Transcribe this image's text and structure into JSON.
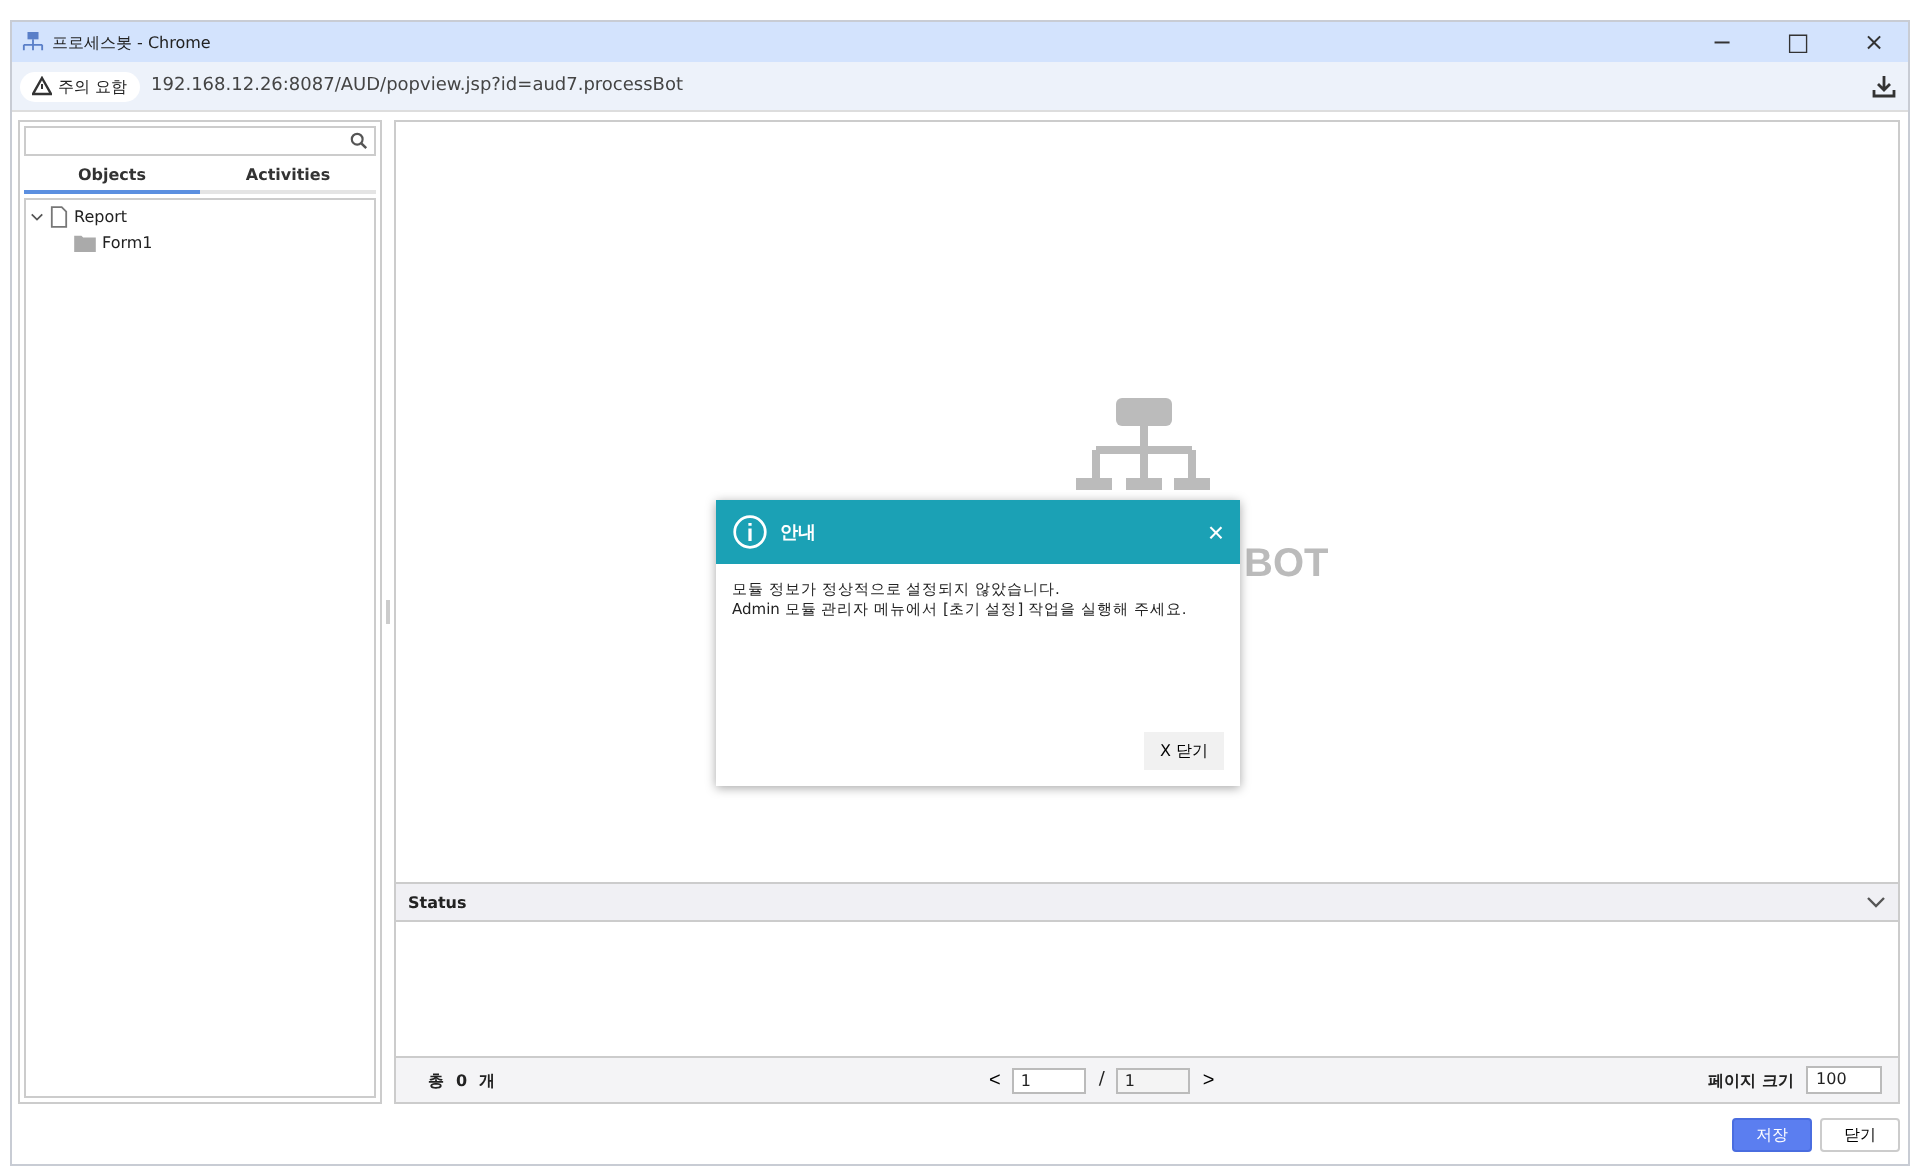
{
  "window": {
    "title": "프로세스봇 - Chrome",
    "controls": [
      "−",
      "□",
      "×"
    ]
  },
  "address_bar": {
    "security_label": "주의 요함",
    "url": "192.168.12.26:8087/AUD/popview.jsp?id=aud7.processBot"
  },
  "sidebar": {
    "tabs": [
      {
        "label": "Objects",
        "selected": true
      },
      {
        "label": "Activities",
        "selected": false
      }
    ],
    "tree": [
      {
        "label": "Report",
        "kind": "document",
        "expanded": true,
        "children": [
          {
            "label": "Form1",
            "kind": "folder"
          }
        ]
      }
    ]
  },
  "canvas": {
    "logo_text": "BOT"
  },
  "dialog": {
    "title": "안내",
    "close": "×",
    "message": [
      "모듈 정보가 정상적으로 설정되지 않았습니다.",
      "Admin 모듈 관리자 메뉴에서 [초기 설정] 작업을 실행해 주세요."
    ],
    "button": "X 닫기"
  },
  "status": {
    "title": "Status",
    "expanded": true
  },
  "pager": {
    "total_label": "총",
    "total": "0",
    "unit": "개",
    "prev": "<",
    "page": "1",
    "separator": "/",
    "pages": "1",
    "next": ">",
    "page_size_label": "페이지 크기",
    "page_size": "100"
  },
  "buttons": [
    {
      "label": "저장",
      "kind": "primary"
    },
    {
      "label": "닫기",
      "kind": "default"
    }
  ]
}
